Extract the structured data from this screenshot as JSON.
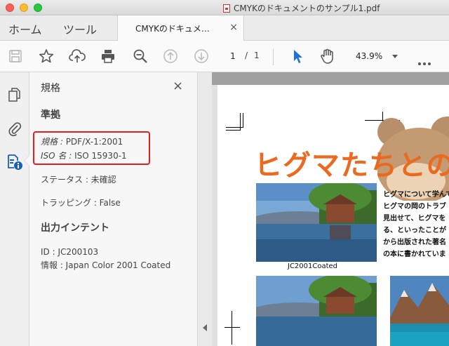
{
  "window": {
    "title": "CMYKのドキュメントのサンプル1.pdf"
  },
  "nav": {
    "home": "ホーム",
    "tools": "ツール",
    "doc_tab": "CMYKのドキュメ…",
    "close": "×"
  },
  "toolbar": {
    "page_current": "1",
    "page_separator": "/",
    "page_total": "1",
    "zoom": "43.9%"
  },
  "panel": {
    "title": "規格",
    "close": "×",
    "section_compliance": "準拠",
    "standard_label": "規格 :",
    "standard_value": "PDF/X-1:2001",
    "iso_label": "ISO 名 :",
    "iso_value": "ISO 15930-1",
    "status": "ステータス : 未確認",
    "trapping": "トラッピング : False",
    "section_intent": "出力インテント",
    "intent_id": "ID : JC200103",
    "intent_info": "情報 : Japan Color 2001 Coated"
  },
  "document": {
    "heading": "ヒグマたちとの",
    "caption": "JC2001Coated",
    "body_lines": [
      "ヒグマについて学んで",
      "ヒグマの岡のトラブ",
      "見出せて、ヒグマを",
      "る、といったことが",
      "から出版された著名",
      "の本に書かれていま"
    ]
  },
  "colors": {
    "accent_orange": "#ea6a21",
    "highlight_red": "#e01f1f",
    "select_blue": "#1a73d9"
  }
}
